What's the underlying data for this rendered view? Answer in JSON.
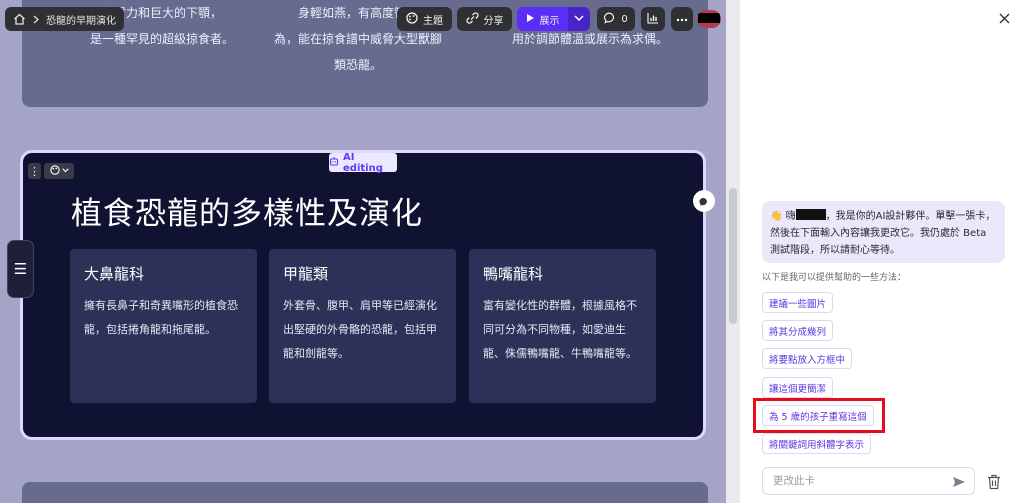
{
  "toolbar": {
    "breadcrumb_title": "恐龍的早期演化",
    "theme_label": "主題",
    "share_label": "分享",
    "present_label": "展示",
    "comments_count": "0"
  },
  "canvas": {
    "top_card": {
      "col1_line1": "的臂力和巨大的下顎，",
      "col1_line2": "是一種罕見的超級掠食者。",
      "col2_line1": "身輕如燕，有高度智商",
      "col2_line2": "為，能在掠食譜中威脅大型獸腳",
      "col2_line3": "類恐龍。",
      "col3_line2": "用於調節體溫或展示為求偶。"
    },
    "ai_badge": "AI editing",
    "main_card": {
      "title": "植食恐龍的多樣性及演化",
      "cards": [
        {
          "title": "大鼻龍科",
          "body": "擁有長鼻子和奇異嘴形的植食恐龍，包括捲角龍和拖尾龍。"
        },
        {
          "title": "甲龍類",
          "body": "外套骨、腹甲、肩甲等已經演化出堅硬的外骨骼的恐龍，包括甲龍和劍龍等。"
        },
        {
          "title": "鴨嘴龍科",
          "body": "富有變化性的群體，根據風格不同可分為不同物種，如愛迪生龍、侏儒鴨嘴龍、牛鴨嘴龍等。"
        }
      ]
    }
  },
  "panel": {
    "greeting_prefix": "👋 嗨",
    "greeting_text": "，我是你的AI設計夥伴。單擊一張卡，然後在下面輸入內容讓我更改它。我仍處於 Beta 測試階段，所以請耐心等待。",
    "help_label": "以下是我可以提供幫助的一些方法：",
    "suggestions": [
      "建議一些圖片",
      "將其分成幾列",
      "將要點放入方框中",
      "讓這個更簡潔",
      "為 5 歲的孩子重寫這個",
      "將關鍵詞用斜體字表示"
    ],
    "input_placeholder": "更改此卡"
  },
  "colors": {
    "accent": "#5a2ef4",
    "card_bg": "#0f1230",
    "highlight": "#e40c19"
  }
}
